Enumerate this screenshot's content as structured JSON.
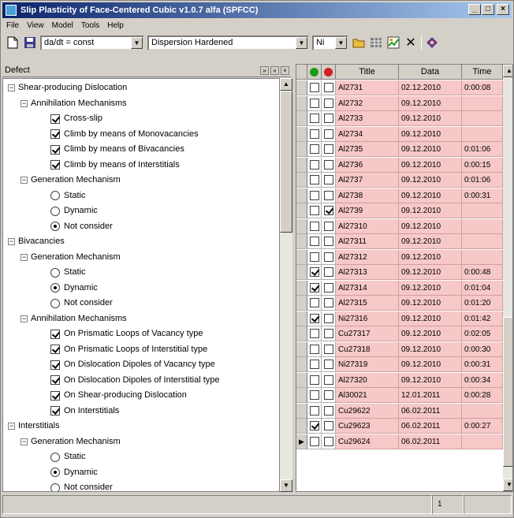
{
  "window": {
    "title": "Slip Plasticity of Face-Centered Cubic v1.0.7 alfa (SPFCC)",
    "controls": [
      "_",
      "□",
      "×"
    ]
  },
  "menu": [
    "File",
    "View",
    "Model",
    "Tools",
    "Help"
  ],
  "toolbar": {
    "equation_combo": "da/dt = const",
    "material_combo": "Dispersion Hardened",
    "element_combo": "Ni"
  },
  "defect_panel": {
    "title": "Defect",
    "tree": [
      {
        "level": 0,
        "kind": "node",
        "label": "Shear-producing Dislocation"
      },
      {
        "level": 1,
        "kind": "node",
        "label": "Annihilation Mechanisms"
      },
      {
        "level": 2,
        "kind": "check",
        "checked": true,
        "label": "Cross-slip"
      },
      {
        "level": 2,
        "kind": "check",
        "checked": true,
        "label": "Climb by means of Monovacancies"
      },
      {
        "level": 2,
        "kind": "check",
        "checked": true,
        "label": "Climb by means of Bivacancies"
      },
      {
        "level": 2,
        "kind": "check",
        "checked": true,
        "label": "Climb by means of Interstitials"
      },
      {
        "level": 1,
        "kind": "node",
        "label": "Generation Mechanism"
      },
      {
        "level": 2,
        "kind": "radio",
        "checked": false,
        "label": "Static"
      },
      {
        "level": 2,
        "kind": "radio",
        "checked": false,
        "label": "Dynamic"
      },
      {
        "level": 2,
        "kind": "radio",
        "checked": true,
        "label": "Not consider"
      },
      {
        "level": 0,
        "kind": "node",
        "label": "Bivacancies"
      },
      {
        "level": 1,
        "kind": "node",
        "label": "Generation Mechanism"
      },
      {
        "level": 2,
        "kind": "radio",
        "checked": false,
        "label": "Static"
      },
      {
        "level": 2,
        "kind": "radio",
        "checked": true,
        "label": "Dynamic"
      },
      {
        "level": 2,
        "kind": "radio",
        "checked": false,
        "label": "Not consider"
      },
      {
        "level": 1,
        "kind": "node",
        "label": "Annihilation Mechanisms"
      },
      {
        "level": 2,
        "kind": "check",
        "checked": true,
        "label": "On Prismatic Loops of Vacancy type"
      },
      {
        "level": 2,
        "kind": "check",
        "checked": true,
        "label": "On Prismatic Loops of Interstitial type"
      },
      {
        "level": 2,
        "kind": "check",
        "checked": true,
        "label": "On Dislocation Dipoles of Vacancy type"
      },
      {
        "level": 2,
        "kind": "check",
        "checked": true,
        "label": "On Dislocation Dipoles of Interstitial type"
      },
      {
        "level": 2,
        "kind": "check",
        "checked": true,
        "label": "On Shear-producing Dislocation"
      },
      {
        "level": 2,
        "kind": "check",
        "checked": true,
        "label": "On Interstitials"
      },
      {
        "level": 0,
        "kind": "node",
        "label": "Interstitials"
      },
      {
        "level": 1,
        "kind": "node",
        "label": "Generation Mechanism"
      },
      {
        "level": 2,
        "kind": "radio",
        "checked": false,
        "label": "Static"
      },
      {
        "level": 2,
        "kind": "radio",
        "checked": true,
        "label": "Dynamic"
      },
      {
        "level": 2,
        "kind": "radio",
        "checked": false,
        "label": "Not consider"
      }
    ]
  },
  "grid": {
    "columns": {
      "title": "Title",
      "date": "Data",
      "time": "Time"
    },
    "rows": [
      {
        "a": false,
        "b": false,
        "title": "Al2731",
        "date": "02.12.2010",
        "time": "0:00:08"
      },
      {
        "a": false,
        "b": false,
        "title": "Al2732",
        "date": "09.12.2010",
        "time": ""
      },
      {
        "a": false,
        "b": false,
        "title": "Al2733",
        "date": "09.12.2010",
        "time": ""
      },
      {
        "a": false,
        "b": false,
        "title": "Al2734",
        "date": "09.12.2010",
        "time": ""
      },
      {
        "a": false,
        "b": false,
        "title": "Al2735",
        "date": "09.12.2010",
        "time": "0:01:06"
      },
      {
        "a": false,
        "b": false,
        "title": "Al2736",
        "date": "09.12.2010",
        "time": "0:00:15"
      },
      {
        "a": false,
        "b": false,
        "title": "Al2737",
        "date": "09.12.2010",
        "time": "0:01:06"
      },
      {
        "a": false,
        "b": false,
        "title": "Al2738",
        "date": "09.12.2010",
        "time": "0:00:31"
      },
      {
        "a": false,
        "b": true,
        "title": "Al2739",
        "date": "09.12.2010",
        "time": ""
      },
      {
        "a": false,
        "b": false,
        "title": "Al27310",
        "date": "09.12.2010",
        "time": ""
      },
      {
        "a": false,
        "b": false,
        "title": "Al27311",
        "date": "09.12.2010",
        "time": ""
      },
      {
        "a": false,
        "b": false,
        "title": "Al27312",
        "date": "09.12.2010",
        "time": ""
      },
      {
        "a": true,
        "b": false,
        "title": "Al27313",
        "date": "09.12.2010",
        "time": "0:00:48"
      },
      {
        "a": true,
        "b": false,
        "title": "Al27314",
        "date": "09.12.2010",
        "time": "0:01:04"
      },
      {
        "a": false,
        "b": false,
        "title": "Al27315",
        "date": "09.12.2010",
        "time": "0:01:20"
      },
      {
        "a": true,
        "b": false,
        "title": "Ni27316",
        "date": "09.12.2010",
        "time": "0:01:42"
      },
      {
        "a": false,
        "b": false,
        "title": "Cu27317",
        "date": "09.12.2010",
        "time": "0:02:05"
      },
      {
        "a": false,
        "b": false,
        "title": "Cu27318",
        "date": "09.12.2010",
        "time": "0:00:30"
      },
      {
        "a": false,
        "b": false,
        "title": "Ni27319",
        "date": "09.12.2010",
        "time": "0:00:31"
      },
      {
        "a": false,
        "b": false,
        "title": "Al27320",
        "date": "09.12.2010",
        "time": "0:00:34"
      },
      {
        "a": false,
        "b": false,
        "title": "Al30021",
        "date": "12.01.2011",
        "time": "0:00:28"
      },
      {
        "a": false,
        "b": false,
        "title": "Cu29622",
        "date": "06.02.2011",
        "time": ""
      },
      {
        "a": true,
        "b": false,
        "title": "Cu29623",
        "date": "06.02.2011",
        "time": "0:00:27"
      },
      {
        "a": false,
        "b": false,
        "title": "Cu29624",
        "date": "06.02.2011",
        "time": "",
        "current": true
      }
    ]
  },
  "status": {
    "count": "1"
  }
}
